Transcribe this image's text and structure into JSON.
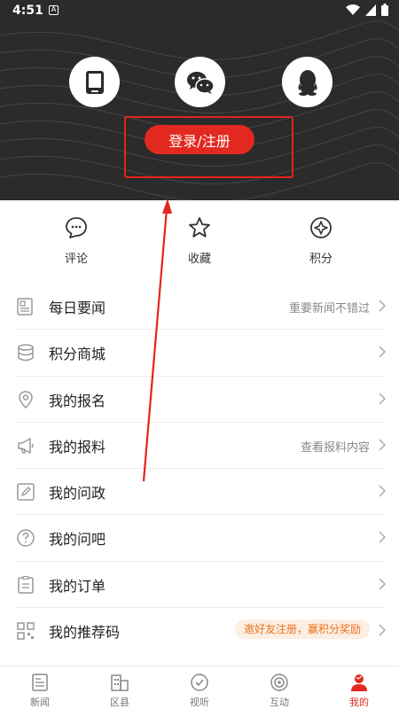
{
  "status_bar": {
    "time": "4:51",
    "notif_letter": "A"
  },
  "login": {
    "button_label": "登录/注册"
  },
  "quick_actions": [
    {
      "label": "评论",
      "icon": "comment-bubble-icon"
    },
    {
      "label": "收藏",
      "icon": "star-icon"
    },
    {
      "label": "积分",
      "icon": "points-compass-icon"
    }
  ],
  "menu": [
    {
      "label": "每日要闻",
      "subtitle": "重要新闻不错过",
      "icon": "newspaper-icon"
    },
    {
      "label": "积分商城",
      "subtitle": "",
      "icon": "coin-stack-icon"
    },
    {
      "label": "我的报名",
      "subtitle": "",
      "icon": "location-pin-icon"
    },
    {
      "label": "我的报料",
      "subtitle": "查看报料内容",
      "icon": "megaphone-icon"
    },
    {
      "label": "我的问政",
      "subtitle": "",
      "icon": "pencil-note-icon"
    },
    {
      "label": "我的问吧",
      "subtitle": "",
      "icon": "question-circle-icon"
    },
    {
      "label": "我的订单",
      "subtitle": "",
      "icon": "clipboard-icon"
    },
    {
      "label": "我的推荐码",
      "badge": "邀好友注册，赢积分奖励",
      "icon": "qr-code-icon"
    }
  ],
  "tabs": [
    {
      "label": "新闻",
      "icon": "news-doc-icon",
      "active": false
    },
    {
      "label": "区县",
      "icon": "buildings-icon",
      "active": false
    },
    {
      "label": "视听",
      "icon": "check-circle-icon",
      "active": false
    },
    {
      "label": "互动",
      "icon": "target-icon",
      "active": false
    },
    {
      "label": "我的",
      "icon": "user-profile-icon",
      "active": true
    }
  ],
  "colors": {
    "accent": "#e2291f",
    "header_bg": "#2b2b2b",
    "badge_text": "#e9731c",
    "badge_bg": "#fdeee2"
  }
}
